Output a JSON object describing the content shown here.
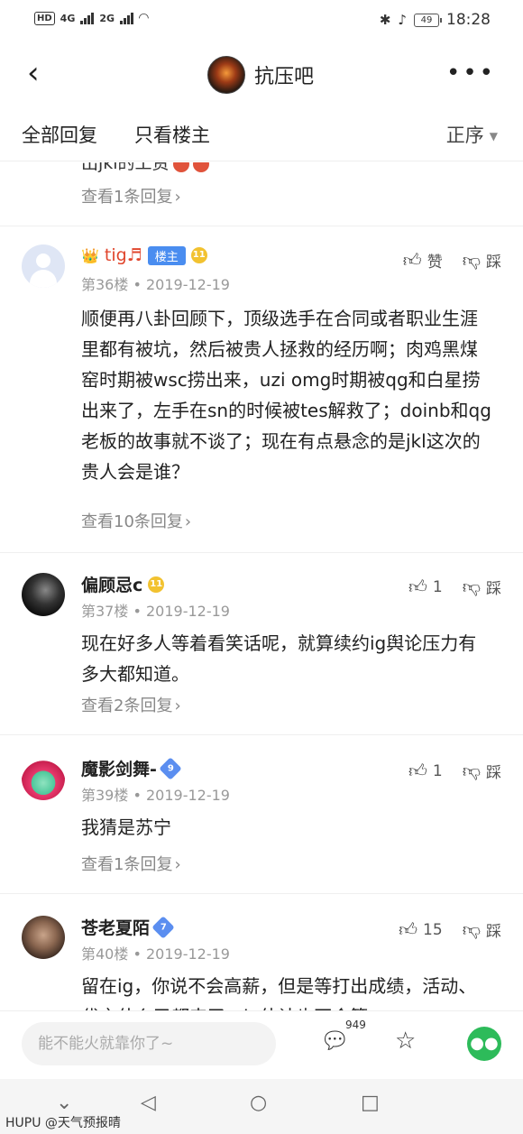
{
  "status_bar": {
    "left": "HD",
    "net1": "4G",
    "net2": "2G",
    "battery": "49",
    "time": "18:28"
  },
  "header": {
    "title": "抗压吧"
  },
  "tabs": {
    "all": "全部回复",
    "op_only": "只看楼主",
    "sort": "正序"
  },
  "partial_post": {
    "text": "出jkl的工资",
    "view_replies": "查看1条回复"
  },
  "posts": [
    {
      "username": "tig♬",
      "crown": "👑",
      "op_badge": "楼主",
      "level": "11",
      "floor": "第36楼",
      "date": "2019-12-19",
      "like": "赞",
      "dislike": "踩",
      "content": "顺便再八卦回顾下，顶级选手在合同或者职业生涯里都有被坑，然后被贵人拯救的经历啊；肉鸡黑煤窑时期被wsc捞出来，uzi omg时期被qg和白星捞出来了，左手在sn的时候被tes解救了；doinb和qg老板的故事就不谈了；现在有点悬念的是jkl这次的贵人会是谁？",
      "view_replies": "查看10条回复"
    },
    {
      "username": "偏顾忌c",
      "level": "11",
      "floor": "第37楼",
      "date": "2019-12-19",
      "like": "1",
      "dislike": "踩",
      "content": "现在好多人等着看笑话呢，就算续约ig舆论压力有多大都知道。",
      "view_replies": "查看2条回复"
    },
    {
      "username": "魔影剑舞-",
      "level": "9",
      "floor": "第39楼",
      "date": "2019-12-19",
      "like": "1",
      "dislike": "踩",
      "content": "我猜是苏宁",
      "view_replies": "查看1条回复"
    },
    {
      "username": "苍老夏陌",
      "level": "7",
      "floor": "第40楼",
      "date": "2019-12-19",
      "like": "15",
      "dislike": "踩",
      "content": "留在ig，你说不会高薪，但是等打出成绩，活动、代言什么又都来了，ig估计也不会算"
    }
  ],
  "bottom_bar": {
    "placeholder": "能不能火就靠你了~",
    "comment_count": "949"
  },
  "watermark": "HUPU @天气预报晴",
  "icons": {
    "back": "back-arrow-icon",
    "more": "more-icon",
    "caret": "caret-down-icon",
    "thumb_up": "thumb-up-icon",
    "thumb_down": "thumb-down-icon",
    "comment": "comment-icon",
    "star": "star-icon",
    "wechat": "wechat-icon"
  },
  "colors": {
    "accent_red": "#e0452c",
    "op_badge": "#4a8df0",
    "wechat": "#2dbb5a"
  }
}
